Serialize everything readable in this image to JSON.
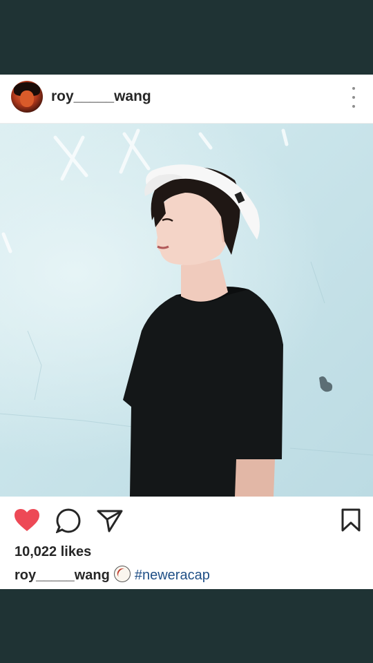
{
  "post": {
    "username": "roy_____wang",
    "likes": "10,022 likes",
    "caption": {
      "username": "roy_____wang",
      "emoji": "baseball",
      "hashtag": "#neweracap"
    },
    "liked": true
  },
  "colors": {
    "background": "#1f3334",
    "like_red": "#ed4956",
    "hashtag_blue": "#1f4f86"
  },
  "icons": [
    "heart-icon",
    "comment-icon",
    "share-icon",
    "bookmark-icon",
    "more-options-icon"
  ]
}
